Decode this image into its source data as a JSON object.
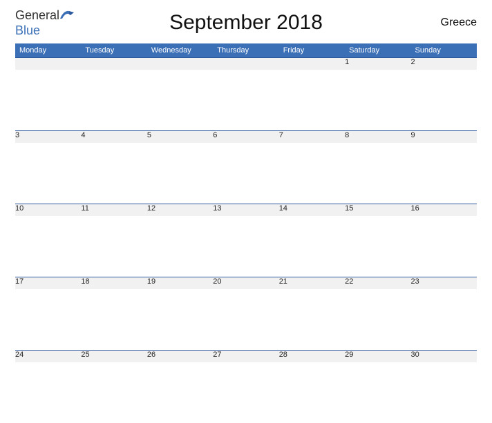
{
  "logo": {
    "general": "General",
    "blue": "Blue"
  },
  "title": "September 2018",
  "country": "Greece",
  "weekdays": [
    "Monday",
    "Tuesday",
    "Wednesday",
    "Thursday",
    "Friday",
    "Saturday",
    "Sunday"
  ],
  "weeks": [
    [
      "",
      "",
      "",
      "",
      "",
      "1",
      "2"
    ],
    [
      "3",
      "4",
      "5",
      "6",
      "7",
      "8",
      "9"
    ],
    [
      "10",
      "11",
      "12",
      "13",
      "14",
      "15",
      "16"
    ],
    [
      "17",
      "18",
      "19",
      "20",
      "21",
      "22",
      "23"
    ],
    [
      "24",
      "25",
      "26",
      "27",
      "28",
      "29",
      "30"
    ]
  ]
}
